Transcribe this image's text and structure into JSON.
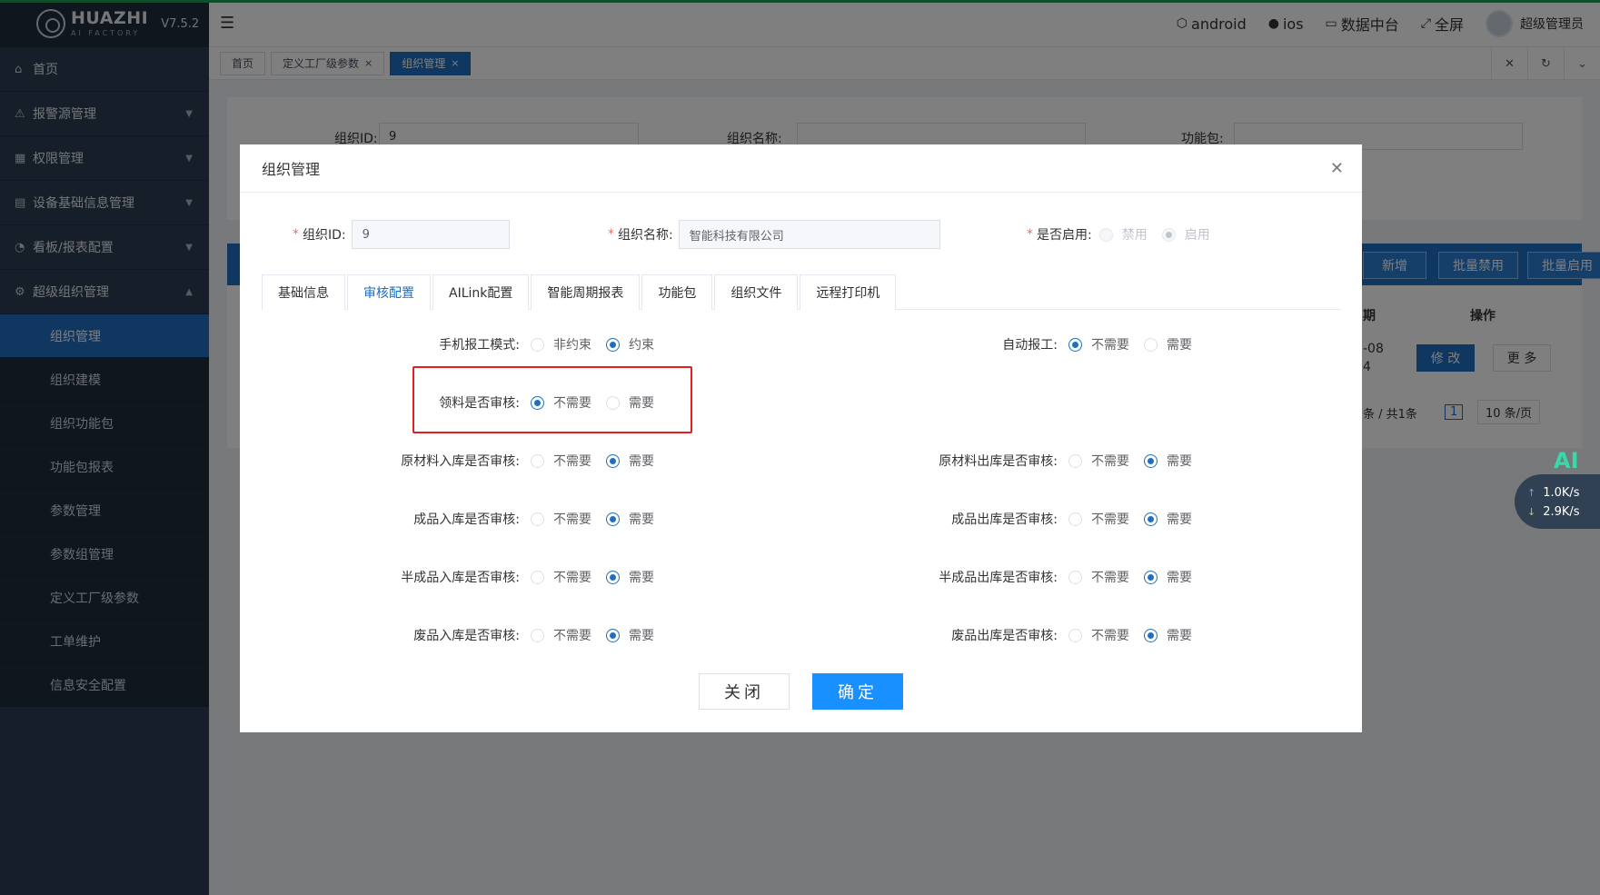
{
  "app": {
    "logo_name": "HUAZHI",
    "logo_sub": "AI FACTORY",
    "version": "V7.5.2"
  },
  "sidebar": {
    "items": [
      {
        "label": "首页",
        "icon": "home-icon"
      },
      {
        "label": "报警源管理",
        "icon": "warning-icon"
      },
      {
        "label": "权限管理",
        "icon": "grid-icon"
      },
      {
        "label": "设备基础信息管理",
        "icon": "document-icon"
      },
      {
        "label": "看板/报表配置",
        "icon": "gauge-icon"
      },
      {
        "label": "超级组织管理",
        "icon": "gear-icon"
      }
    ],
    "subitems": [
      "组织管理",
      "组织建模",
      "组织功能包",
      "功能包报表",
      "参数管理",
      "参数组管理",
      "定义工厂级参数",
      "工单维护",
      "信息安全配置"
    ]
  },
  "header": {
    "links": [
      {
        "label": "android",
        "icon": "android-icon"
      },
      {
        "label": "ios",
        "icon": "apple-icon"
      },
      {
        "label": "数据中台",
        "icon": "chart-icon"
      },
      {
        "label": "全屏",
        "icon": "fullscreen-icon"
      }
    ],
    "user": "超级管理员"
  },
  "tabs": [
    {
      "label": "首页",
      "closable": false
    },
    {
      "label": "定义工厂级参数",
      "closable": true
    },
    {
      "label": "组织管理",
      "closable": true,
      "active": true
    }
  ],
  "filter": {
    "org_id_label": "组织ID:",
    "org_id_value": "9",
    "org_name_label": "组织名称:",
    "pkg_label": "功能包:"
  },
  "table": {
    "buttons": [
      "新增",
      "批量禁用",
      "批量启用"
    ],
    "col_date_partial": "期",
    "col_ops": "操作",
    "row_date_partial_1": "-08",
    "row_date_partial_2": "4",
    "edit_label": "修 改",
    "more_label": "更 多",
    "pager_total": "条 / 共1条",
    "pager_page": "1",
    "pager_size": "10 条/页"
  },
  "net_widget": {
    "ai": "AI",
    "up": "1.0K/s",
    "down": "2.9K/s"
  },
  "dialog": {
    "title": "组织管理",
    "org_id_label": "组织ID:",
    "org_id_value": "9",
    "org_name_label": "组织名称:",
    "org_name_value": "智能科技有限公司",
    "enabled_label": "是否启用:",
    "enabled_options": [
      "禁用",
      "启用"
    ],
    "enabled_selected": "启用",
    "tabs": [
      "基础信息",
      "审核配置",
      "AILink配置",
      "智能周期报表",
      "功能包",
      "组织文件",
      "远程打印机"
    ],
    "active_tab": "审核配置",
    "settings": {
      "phone_mode": {
        "label": "手机报工模式:",
        "options": [
          "非约束",
          "约束"
        ],
        "selected": "约束"
      },
      "auto_report": {
        "label": "自动报工:",
        "options": [
          "不需要",
          "需要"
        ],
        "selected": "不需要"
      },
      "material_audit": {
        "label": "领料是否审核:",
        "options": [
          "不需要",
          "需要"
        ],
        "selected": "不需要"
      },
      "raw_in": {
        "label": "原材料入库是否审核:",
        "options": [
          "不需要",
          "需要"
        ],
        "selected": "需要"
      },
      "raw_out": {
        "label": "原材料出库是否审核:",
        "options": [
          "不需要",
          "需要"
        ],
        "selected": "需要"
      },
      "fin_in": {
        "label": "成品入库是否审核:",
        "options": [
          "不需要",
          "需要"
        ],
        "selected": "需要"
      },
      "fin_out": {
        "label": "成品出库是否审核:",
        "options": [
          "不需要",
          "需要"
        ],
        "selected": "需要"
      },
      "semi_in": {
        "label": "半成品入库是否审核:",
        "options": [
          "不需要",
          "需要"
        ],
        "selected": "需要"
      },
      "semi_out": {
        "label": "半成品出库是否审核:",
        "options": [
          "不需要",
          "需要"
        ],
        "selected": "需要"
      },
      "waste_in": {
        "label": "废品入库是否审核:",
        "options": [
          "不需要",
          "需要"
        ],
        "selected": "需要"
      },
      "waste_out": {
        "label": "废品出库是否审核:",
        "options": [
          "不需要",
          "需要"
        ],
        "selected": "需要"
      }
    },
    "cancel_label": "关闭",
    "ok_label": "确定"
  },
  "colors": {
    "primary": "#1e6fc0",
    "confirm": "#1890ff",
    "highlight": "#e02020",
    "sidebar": "#2b3c52"
  }
}
